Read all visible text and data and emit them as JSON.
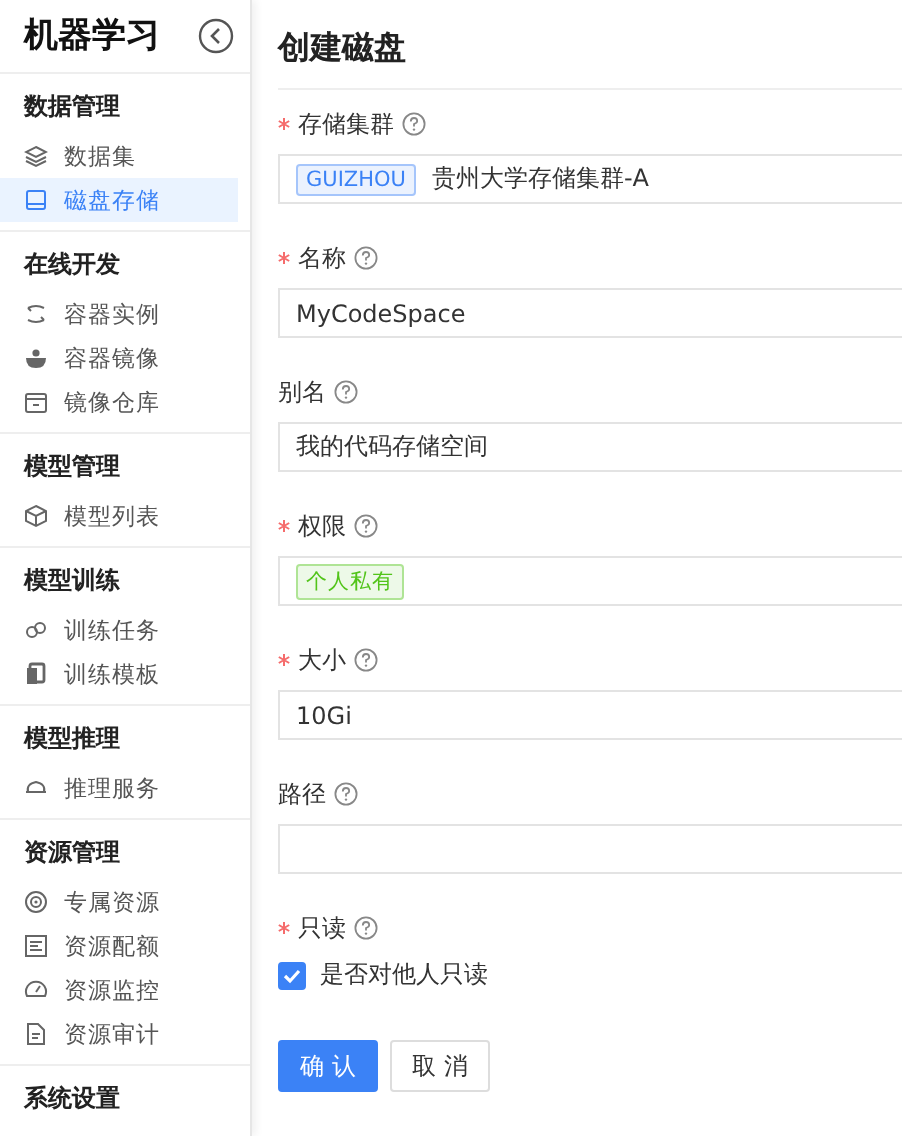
{
  "sidebar": {
    "title": "机器学习",
    "sections": [
      {
        "header": "数据管理",
        "items": [
          {
            "label": "数据集",
            "selected": false
          },
          {
            "label": "磁盘存储",
            "selected": true
          }
        ]
      },
      {
        "header": "在线开发",
        "items": [
          {
            "label": "容器实例",
            "selected": false
          },
          {
            "label": "容器镜像",
            "selected": false
          },
          {
            "label": "镜像仓库",
            "selected": false
          }
        ]
      },
      {
        "header": "模型管理",
        "items": [
          {
            "label": "模型列表",
            "selected": false
          }
        ]
      },
      {
        "header": "模型训练",
        "items": [
          {
            "label": "训练任务",
            "selected": false
          },
          {
            "label": "训练模板",
            "selected": false
          }
        ]
      },
      {
        "header": "模型推理",
        "items": [
          {
            "label": "推理服务",
            "selected": false
          }
        ]
      },
      {
        "header": "资源管理",
        "items": [
          {
            "label": "专属资源",
            "selected": false
          },
          {
            "label": "资源配额",
            "selected": false
          },
          {
            "label": "资源监控",
            "selected": false
          },
          {
            "label": "资源审计",
            "selected": false
          }
        ]
      },
      {
        "header": "系统设置"
      }
    ]
  },
  "page": {
    "title": "创建磁盘"
  },
  "form": {
    "fields": [
      {
        "kind": "select",
        "label": "存储集群",
        "required": true,
        "tag": {
          "text": "GUIZHOU",
          "color": "#3b82f6"
        },
        "value": "贵州大学存储集群-A"
      },
      {
        "kind": "input",
        "label": "名称",
        "required": true,
        "value": "MyCodeSpace"
      },
      {
        "kind": "input",
        "label": "别名",
        "required": false,
        "value": "我的代码存储空间"
      },
      {
        "kind": "select",
        "label": "权限",
        "required": true,
        "tag": {
          "text": "个人私有",
          "color": "#52c41a"
        }
      },
      {
        "kind": "input",
        "label": "大小",
        "required": true,
        "value": "10Gi"
      },
      {
        "kind": "input",
        "label": "路径",
        "required": false
      },
      {
        "kind": "checkbox",
        "label": "只读",
        "required": true,
        "option": "是否对他人只读",
        "checked": true
      }
    ]
  },
  "buttons": [
    {
      "kind": "primary",
      "label": "确 认"
    },
    {
      "kind": "default",
      "label": "取 消"
    }
  ]
}
